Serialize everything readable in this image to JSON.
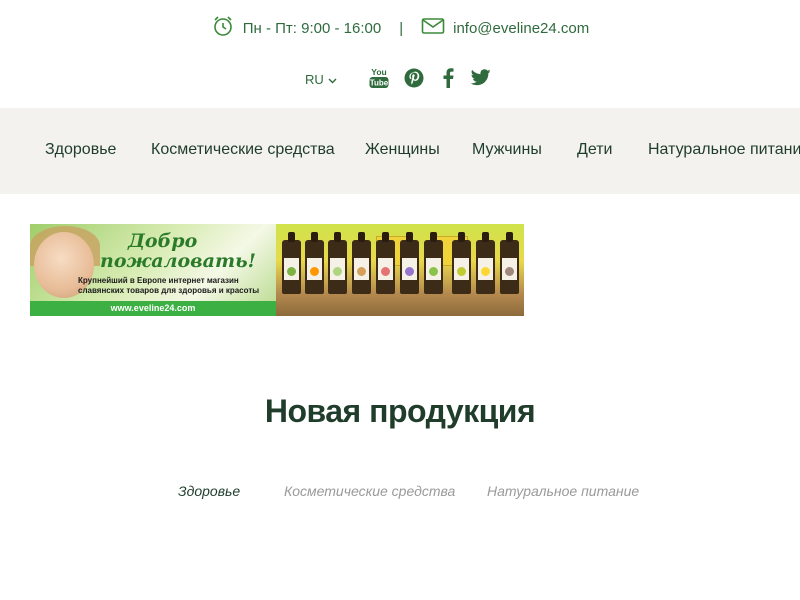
{
  "topbar": {
    "hours": "Пн - Пт: 9:00 - 16:00",
    "separator": "|",
    "email": "info@eveline24.com"
  },
  "icons": {
    "clock": "alarm-clock-icon",
    "mail": "envelope-icon",
    "youtube": "youtube-icon",
    "pinterest": "pinterest-icon",
    "facebook": "facebook-icon",
    "twitter": "twitter-icon",
    "lang_caret": "chevron-down-icon"
  },
  "language": {
    "selected": "RU"
  },
  "social": {
    "youtube_line1": "You",
    "youtube_line2": "Tube"
  },
  "nav": {
    "items": [
      "Здоровье",
      "Косметические средства",
      "Женщины",
      "Мужчины",
      "Дети",
      "Натуральное питание"
    ]
  },
  "banner": {
    "title_line1": "Добро",
    "title_line2": "пожаловать!",
    "subtitle_line1": "Крупнейший в Европе интернет магазин",
    "subtitle_line2": "славянских товаров для здоровья и красоты",
    "url": "www.eveline24.com"
  },
  "section": {
    "title": "Новая продукция",
    "tabs": [
      {
        "label": "Здоровье",
        "active": true
      },
      {
        "label": "Косметические средства",
        "active": false
      },
      {
        "label": "Натуральное питание",
        "active": false
      }
    ]
  },
  "colors": {
    "brand_green": "#2f6b3d",
    "nav_background": "#f3f2ef",
    "banner_strip": "#3cb043",
    "heading": "#1f3d2a",
    "inactive_tab": "#9a9a9a"
  }
}
